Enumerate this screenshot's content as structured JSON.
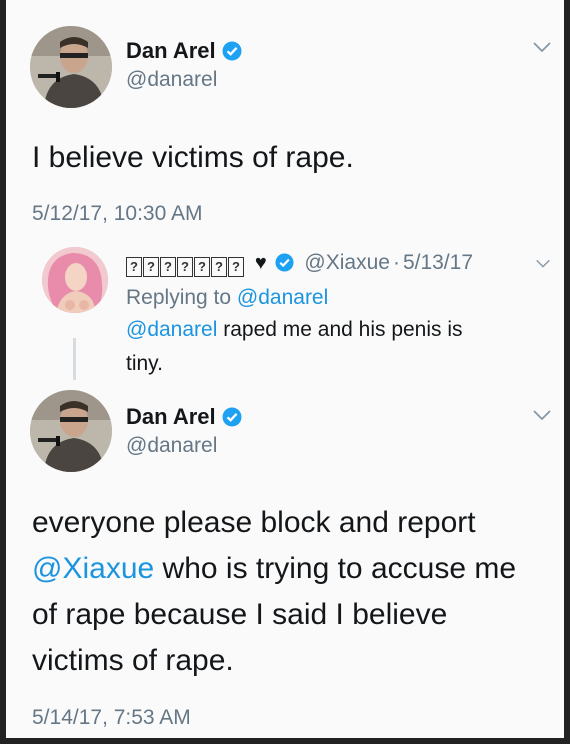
{
  "tweet1": {
    "name": "Dan Arel",
    "handle": "@danarel",
    "text": "I believe victims of rape.",
    "timestamp": "5/12/17, 10:30 AM"
  },
  "reply": {
    "display_name_glyphs": [
      "?",
      "?",
      "?",
      "?",
      "?",
      "?",
      "?"
    ],
    "heart": "♥",
    "handle": "@Xiaxue",
    "separator": "·",
    "date": "5/13/17",
    "replying_prefix": "Replying to",
    "replying_to": "@danarel",
    "mention": "@danarel",
    "text": "raped me and his penis is",
    "text_line2": "tiny."
  },
  "tweet2": {
    "name": "Dan Arel",
    "handle": "@danarel",
    "line1": "everyone please block and report",
    "mention": "@Xiaxue",
    "line2_rest": "who is trying to accuse me",
    "line3": "of rape because I said I believe",
    "line4": "victims of rape.",
    "timestamp": "5/14/17, 7:53 AM"
  },
  "colors": {
    "link": "#1b95e0",
    "verified": "#1da1f2",
    "secondary": "#657786"
  },
  "icons": [
    "verified-badge-icon",
    "chevron-down-icon",
    "heart-icon"
  ]
}
